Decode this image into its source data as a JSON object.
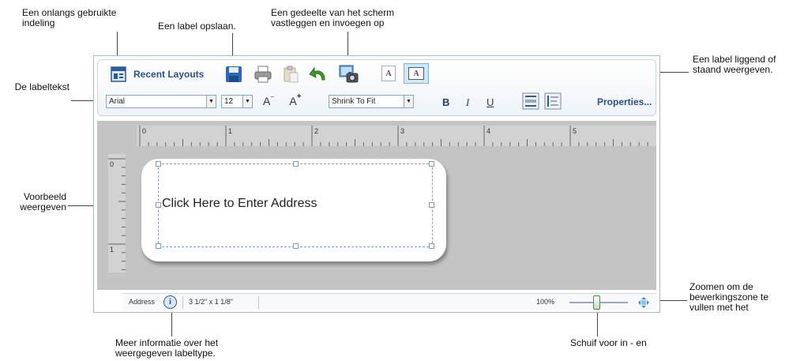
{
  "callouts": {
    "recent_layout": "Een onlangs gebruikte indeling",
    "save_label": "Een label opslaan.",
    "capture_screen": "Een gedeelte van het scherm vastleggen en invoegen op",
    "orientation": "Een label liggend of staand weergeven.",
    "label_text": "De labeltekst",
    "preview": "Voorbeeld weergeven",
    "zoom_fit": "Zoomen om de bewerkingszone te vullen met het",
    "more_info": "Meer informatie over het weergegeven labeltype.",
    "slider": "Schuif voor in - en"
  },
  "toolbar": {
    "recent_layouts": "Recent Layouts",
    "font": "Arial",
    "font_size": "12",
    "fit_mode": "Shrink To Fit",
    "bold": "B",
    "italic": "I",
    "underline": "U",
    "properties": "Properties...",
    "orient_letter": "A",
    "decrease_font": "A",
    "increase_font": "A"
  },
  "ruler": {
    "h_labels": [
      "0",
      "1",
      "2",
      "3",
      "4",
      "5"
    ],
    "v_labels": [
      "0",
      "1"
    ]
  },
  "label": {
    "placeholder": "Click Here to Enter Address"
  },
  "status": {
    "type": "Address",
    "info_glyph": "i",
    "size": "3 1/2\" x 1 1/8\"",
    "zoom": "100%"
  },
  "colors": {
    "accent": "#2b4f8a",
    "editor_bg": "#c4c4c4",
    "selection": "#7e9cc8"
  },
  "icons": [
    "recent-layouts-icon",
    "save-icon",
    "print-icon",
    "paste-icon",
    "undo-icon",
    "screen-capture-icon",
    "landscape-icon",
    "portrait-icon",
    "decrease-font-icon",
    "increase-font-icon",
    "align-middle-icon",
    "align-left-icon",
    "info-icon",
    "zoom-slider-icon",
    "zoom-fit-icon"
  ]
}
